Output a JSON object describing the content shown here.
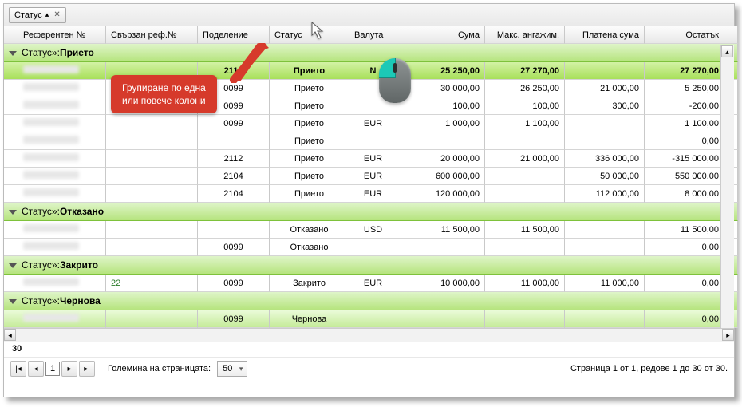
{
  "grouping": {
    "tag": "Статус"
  },
  "columns": {
    "ref": "Референтен №",
    "rref": "Свързан реф.№",
    "pod": "Поделение",
    "status": "Статус",
    "currency": "Валута",
    "sum": "Сума",
    "max": "Макс. ангажим.",
    "paid": "Платена сума",
    "rest": "Остатък"
  },
  "group_prefix": "Статус»:",
  "groups": [
    {
      "name": "Прието",
      "rows": [
        {
          "selected": true,
          "pod": "2112",
          "status": "Прието",
          "currency": "N",
          "sum": "25 250,00",
          "max": "27 270,00",
          "rest": "27 270,00"
        },
        {
          "pod": "0099",
          "status": "Прието",
          "sum": "30 000,00",
          "max": "26 250,00",
          "paid": "21 000,00",
          "rest": "5 250,00"
        },
        {
          "pod": "0099",
          "status": "Прието",
          "sum": "100,00",
          "max": "100,00",
          "paid": "300,00",
          "rest": "-200,00"
        },
        {
          "pod": "0099",
          "status": "Прието",
          "currency": "EUR",
          "sum": "1 000,00",
          "max": "1 100,00",
          "rest": "1 100,00"
        },
        {
          "status": "Прието",
          "rest": "0,00"
        },
        {
          "pod": "2112",
          "status": "Прието",
          "currency": "EUR",
          "sum": "20 000,00",
          "max": "21 000,00",
          "paid": "336 000,00",
          "rest": "-315 000,00"
        },
        {
          "pod": "2104",
          "status": "Прието",
          "currency": "EUR",
          "sum": "600 000,00",
          "paid": "50 000,00",
          "rest": "550 000,00"
        },
        {
          "pod": "2104",
          "status": "Прието",
          "currency": "EUR",
          "sum": "120 000,00",
          "paid": "112 000,00",
          "rest": "8 000,00"
        }
      ]
    },
    {
      "name": "Отказано",
      "rows": [
        {
          "status": "Отказано",
          "currency": "USD",
          "sum": "11 500,00",
          "max": "11 500,00",
          "rest": "11 500,00"
        },
        {
          "pod": "0099",
          "status": "Отказано",
          "rest": "0,00"
        }
      ]
    },
    {
      "name": "Закрито",
      "rows": [
        {
          "rref": "22",
          "pod": "0099",
          "status": "Закрито",
          "currency": "EUR",
          "sum": "10 000,00",
          "max": "11 000,00",
          "paid": "11 000,00",
          "rest": "0,00"
        }
      ]
    },
    {
      "name": "Чернова",
      "rows": [
        {
          "last": true,
          "pod": "0099",
          "status": "Чернова",
          "rest": "0,00"
        }
      ]
    }
  ],
  "tooltip": {
    "line1": "Групиране по една",
    "line2": "или повече колони"
  },
  "footer": {
    "total": "30",
    "page_size_label": "Големина на страницата:",
    "page_size_value": "50",
    "page_num": "1",
    "info": "Страница 1 от 1, редове 1 до 30 от 30."
  }
}
